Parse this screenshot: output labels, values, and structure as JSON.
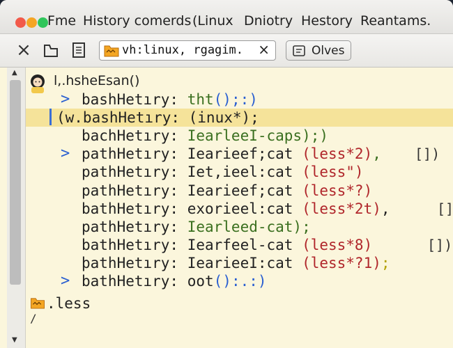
{
  "menubar": {
    "items": [
      "Fme",
      "History comerds",
      "(Linux",
      "Dniotry",
      "Hestory",
      "Reantams."
    ]
  },
  "toolbar": {
    "address_text": "vh:linux, rgagim.",
    "close_label": "×",
    "olives_label": "Olves"
  },
  "terminal": {
    "header": "l,.hsheEsan()",
    "lines": [
      {
        "marker": ">",
        "segments": [
          {
            "t": "bashHetıry: ",
            "c": "dark"
          },
          {
            "t": "tht",
            "c": "green"
          },
          {
            "t": "();:)",
            "c": "blue"
          }
        ]
      },
      {
        "segments": [
          {
            "t": "(w.bashHetıry: (inux*);",
            "c": "dark"
          }
        ],
        "highlight": true
      },
      {
        "segments": [
          {
            "t": "bachHetıry: ",
            "c": "dark"
          },
          {
            "t": "IearleeI-caps);)",
            "c": "green"
          }
        ]
      },
      {
        "marker": ">",
        "segments": [
          {
            "t": "pathHetıry: Iearieef;cat ",
            "c": "dark"
          },
          {
            "t": "(less*2)",
            "c": "red"
          },
          {
            "t": ",",
            "c": "green"
          }
        ],
        "box": "[])"
      },
      {
        "segments": [
          {
            "t": "pathHetıry: Iet,ieel:cat ",
            "c": "dark"
          },
          {
            "t": "(less\")",
            "c": "red"
          }
        ]
      },
      {
        "segments": [
          {
            "t": "pathHetıry: Iearieef;cat ",
            "c": "dark"
          },
          {
            "t": "(less*?)",
            "c": "red"
          }
        ]
      },
      {
        "segments": [
          {
            "t": "bathHetıry: exorieel:cat ",
            "c": "dark"
          },
          {
            "t": "(less*2t)",
            "c": "red"
          },
          {
            "t": ",",
            "c": "dark"
          }
        ],
        "box": "[])"
      },
      {
        "segments": [
          {
            "t": "pathHetıry: ",
            "c": "dark"
          },
          {
            "t": "Iearleed-cat);",
            "c": "green"
          }
        ]
      },
      {
        "segments": [
          {
            "t": "bathHetıry: Iearfeel-cat ",
            "c": "dark"
          },
          {
            "t": "(less*8)",
            "c": "red"
          }
        ],
        "box": "[])"
      },
      {
        "segments": [
          {
            "t": "þathHetıry: IearieeI:cat ",
            "c": "dark"
          },
          {
            "t": "(less*?1)",
            "c": "red"
          },
          {
            "t": ";",
            "c": "yellow"
          }
        ]
      },
      {
        "marker": ">",
        "segments": [
          {
            "t": "bathHetıry: oot",
            "c": "dark"
          },
          {
            "t": "():.:)",
            "c": "blue"
          }
        ]
      }
    ],
    "footer": ".less",
    "prompt_tail": "/"
  },
  "colors": {
    "background": "#fbf6dc",
    "highlight": "#f5e39a",
    "accent": "#2a5fd1"
  }
}
